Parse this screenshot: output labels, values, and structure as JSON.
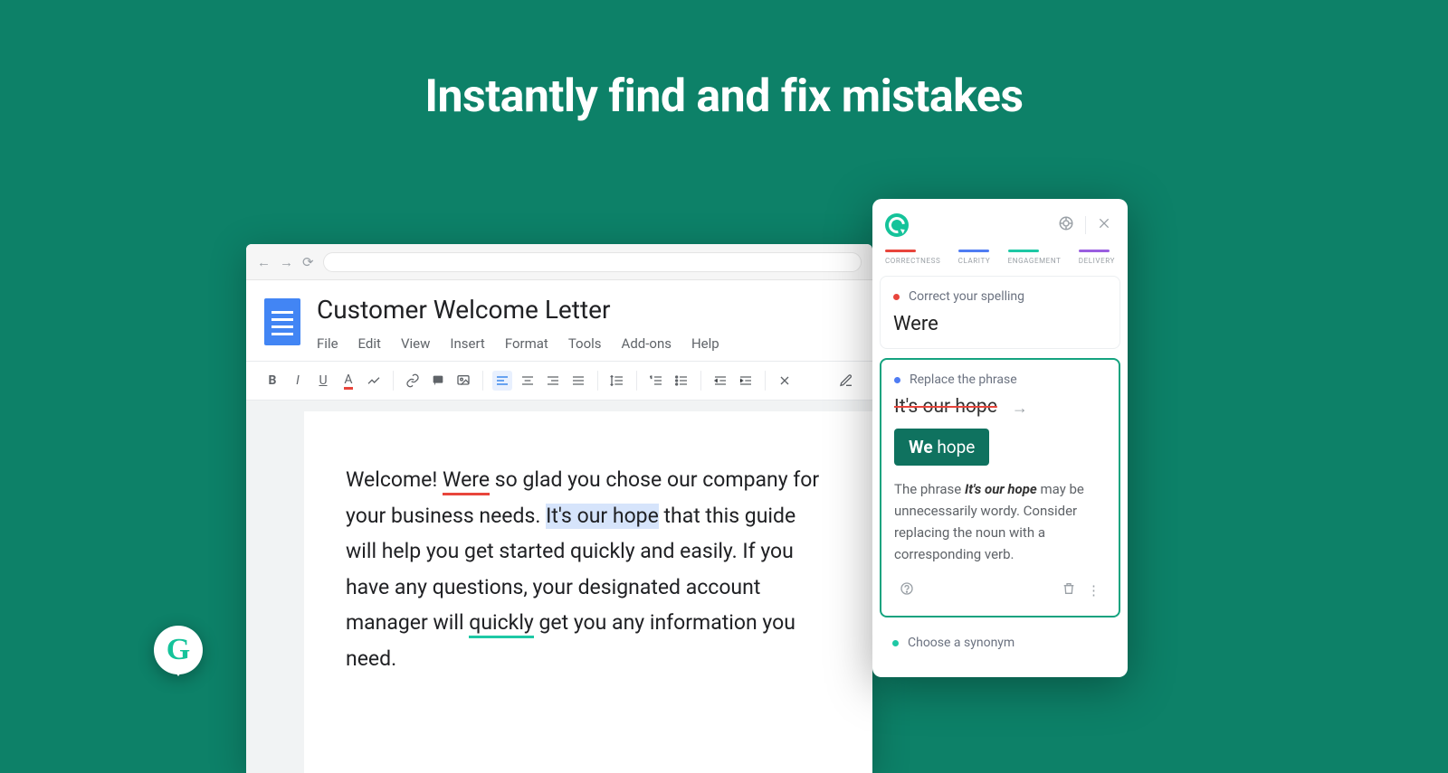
{
  "hero": {
    "title": "Instantly find and fix mistakes"
  },
  "doc": {
    "title": "Customer Welcome Letter",
    "menu": [
      "File",
      "Edit",
      "View",
      "Insert",
      "Format",
      "Tools",
      "Add-ons",
      "Help"
    ],
    "body": {
      "t1": "Welcome! ",
      "err1": "Were",
      "t2": " so glad you chose our company for your business needs. ",
      "err2": "It's our hope",
      "t3": " that this guide will help you get started quickly and easily. If you have any questions, your designated account manager will ",
      "err3": "quickly",
      "t4": " get you any information you need."
    }
  },
  "panel": {
    "cats": [
      {
        "label": "CORRECTNESS",
        "color": "red"
      },
      {
        "label": "CLARITY",
        "color": "blue"
      },
      {
        "label": "ENGAGEMENT",
        "color": "green"
      },
      {
        "label": "DELIVERY",
        "color": "purple"
      }
    ],
    "card1": {
      "hdr": "Correct your spelling",
      "big": "Were"
    },
    "card2": {
      "hdr": "Replace the phrase",
      "strike": "It's our hope",
      "suggest_bold": "We",
      "suggest_rest": " hope",
      "explain_a": "The phrase ",
      "explain_b": "It's our hope",
      "explain_c": " may be unnecessarily wordy. Consider replacing the noun with a corresponding verb."
    },
    "card3": {
      "hdr": "Choose a synonym"
    }
  }
}
